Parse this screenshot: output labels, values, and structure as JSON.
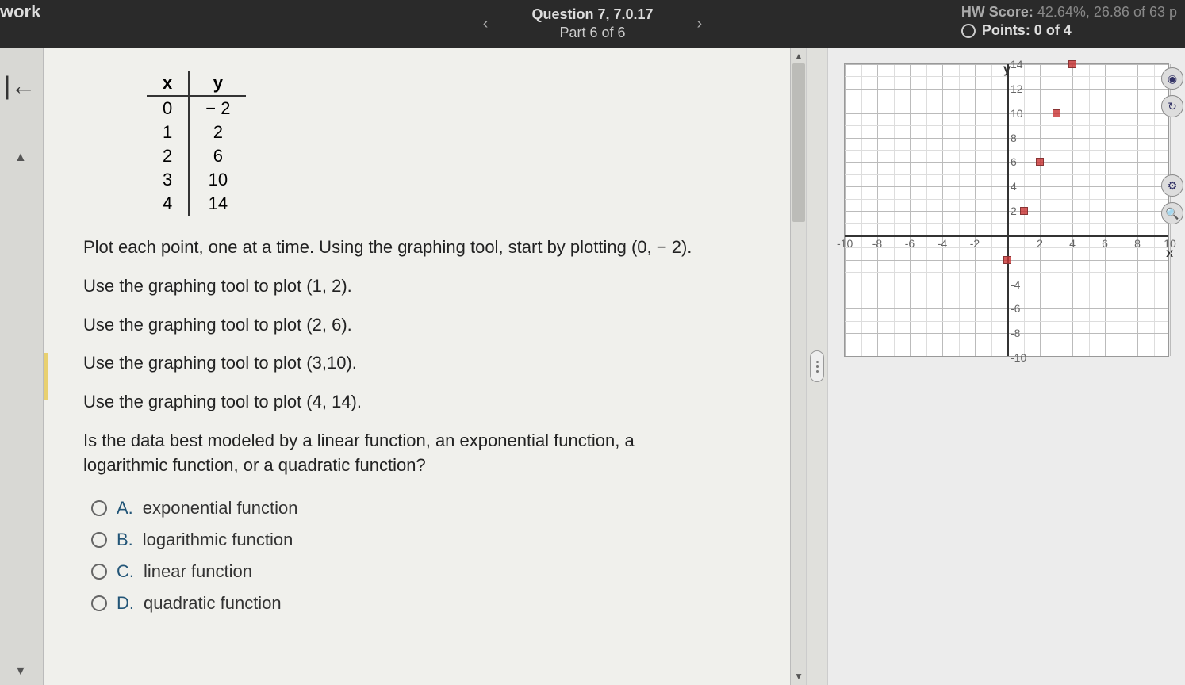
{
  "header": {
    "left_text": "work",
    "question_label": "Question 7, 7.0.17",
    "part_label": "Part 6 of 6",
    "hw_score_label": "HW Score:",
    "hw_score_value": "42.64%, 26.86 of 63 p",
    "points_label": "Points: 0 of 4"
  },
  "table": {
    "headers": [
      "x",
      "y"
    ],
    "rows": [
      [
        "0",
        "− 2"
      ],
      [
        "1",
        "2"
      ],
      [
        "2",
        "6"
      ],
      [
        "3",
        "10"
      ],
      [
        "4",
        "14"
      ]
    ]
  },
  "instructions": [
    "Plot each point, one at a time. Using the graphing tool, start by plotting (0, − 2).",
    "Use the graphing tool to plot (1, 2).",
    "Use the graphing tool to plot (2, 6).",
    "Use the graphing tool to plot (3,10).",
    "Use the graphing tool to plot (4, 14)."
  ],
  "question": "Is the data best modeled by a linear function, an exponential function, a logarithmic function, or a quadratic function?",
  "options": [
    {
      "letter": "A.",
      "text": "exponential function"
    },
    {
      "letter": "B.",
      "text": "logarithmic function"
    },
    {
      "letter": "C.",
      "text": "linear function"
    },
    {
      "letter": "D.",
      "text": "quadratic function"
    }
  ],
  "chart_data": {
    "type": "scatter",
    "title": "",
    "xlabel": "x",
    "ylabel": "y",
    "xlim": [
      -10,
      10
    ],
    "ylim": [
      -10,
      14
    ],
    "xticks": [
      -10,
      -8,
      -6,
      -4,
      -2,
      2,
      4,
      6,
      8,
      10
    ],
    "yticks": [
      -10,
      -8,
      -6,
      -4,
      2,
      4,
      6,
      8,
      10,
      12,
      14
    ],
    "series": [
      {
        "name": "points",
        "color": "#c83232",
        "points": [
          {
            "x": 4,
            "y": 14
          },
          {
            "x": 3,
            "y": 10
          },
          {
            "x": 2,
            "y": 6
          },
          {
            "x": 1,
            "y": 2
          },
          {
            "x": 0,
            "y": -2
          }
        ]
      }
    ]
  }
}
